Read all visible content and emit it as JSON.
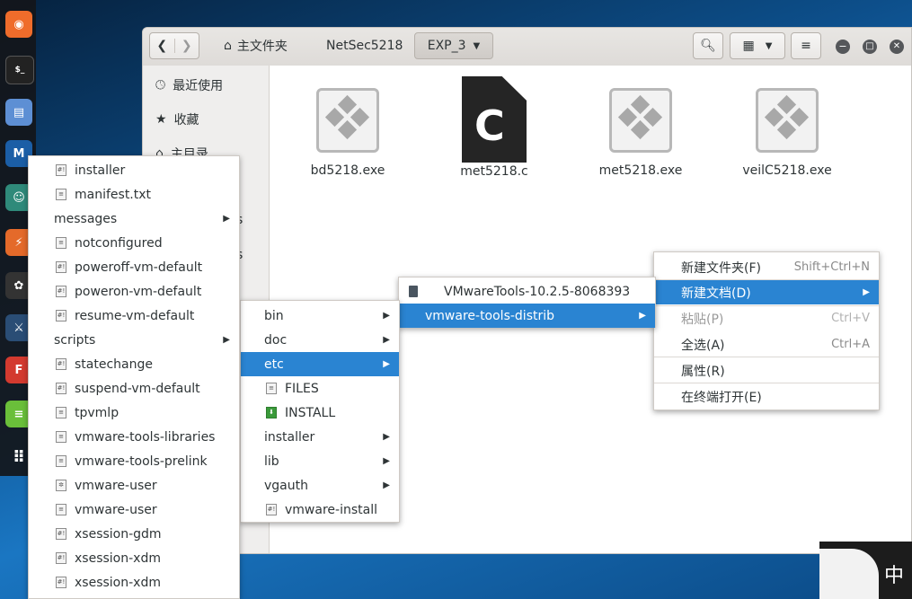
{
  "colors": {
    "selection": "#2a84d2",
    "dock": "#14161a",
    "desktop": "#0d4f8b"
  },
  "dock": {
    "icons": [
      "firefox-icon",
      "terminal-icon",
      "files-icon",
      "metasploit-icon",
      "avatar-app-icon",
      "burp-icon",
      "maltego-icon",
      "kali-icon",
      "faraday-icon",
      "leafpad-icon",
      "app-grid-icon"
    ]
  },
  "window": {
    "breadcrumbs": {
      "home": "主文件夹",
      "folder": "NetSec5218",
      "current": "EXP_3"
    },
    "sidebar": {
      "recent": "最近使用",
      "starred": "收藏",
      "home": "主目录",
      "partial1": "s",
      "partial2": "s"
    },
    "files": [
      {
        "name": "bd5218.exe",
        "type": "exe"
      },
      {
        "name": "met5218.c",
        "type": "c"
      },
      {
        "name": "met5218.exe",
        "type": "exe"
      },
      {
        "name": "veilC5218.exe",
        "type": "exe"
      }
    ]
  },
  "menu_scripts": {
    "items": [
      {
        "label": "installer",
        "icon": "script"
      },
      {
        "label": "manifest.txt",
        "icon": "text"
      },
      {
        "label": "messages",
        "submenu": true
      },
      {
        "label": "notconfigured",
        "icon": "text"
      },
      {
        "label": "poweroff-vm-default",
        "icon": "script"
      },
      {
        "label": "poweron-vm-default",
        "icon": "script"
      },
      {
        "label": "resume-vm-default",
        "icon": "script"
      },
      {
        "label": "scripts",
        "submenu": true
      },
      {
        "label": "statechange",
        "icon": "script"
      },
      {
        "label": "suspend-vm-default",
        "icon": "script"
      },
      {
        "label": "tpvmlp",
        "icon": "text"
      },
      {
        "label": "vmware-tools-libraries",
        "icon": "text"
      },
      {
        "label": "vmware-tools-prelink",
        "icon": "text"
      },
      {
        "label": "vmware-user",
        "icon": "gear"
      },
      {
        "label": "vmware-user",
        "icon": "text"
      },
      {
        "label": "xsession-gdm",
        "icon": "script"
      },
      {
        "label": "xsession-xdm",
        "icon": "script"
      },
      {
        "label": "xsession-xdm",
        "icon": "script"
      }
    ]
  },
  "menu_distrib": {
    "items": [
      {
        "label": "bin",
        "submenu": true
      },
      {
        "label": "doc",
        "submenu": true
      },
      {
        "label": "etc",
        "submenu": true,
        "selected": true
      },
      {
        "label": "FILES",
        "icon": "text"
      },
      {
        "label": "INSTALL",
        "icon": "install"
      },
      {
        "label": "installer",
        "submenu": true
      },
      {
        "label": "lib",
        "submenu": true
      },
      {
        "label": "vgauth",
        "submenu": true
      },
      {
        "label": "vmware-install",
        "icon": "script"
      }
    ]
  },
  "menu_tools": {
    "items": [
      {
        "label": "VMwareTools-10.2.5-8068393",
        "icon": "archive"
      },
      {
        "label": "vmware-tools-distrib",
        "submenu": true,
        "selected": true
      }
    ]
  },
  "menu_context": {
    "new_folder": "新建文件夹(F)",
    "new_folder_acc": "Shift+Ctrl+N",
    "new_doc": "新建文档(D)",
    "paste": "粘贴(P)",
    "paste_acc": "Ctrl+V",
    "select_all": "全选(A)",
    "select_all_acc": "Ctrl+A",
    "properties": "属性(R)",
    "open_terminal": "在终端打开(E)"
  },
  "ime": {
    "label": "中"
  }
}
